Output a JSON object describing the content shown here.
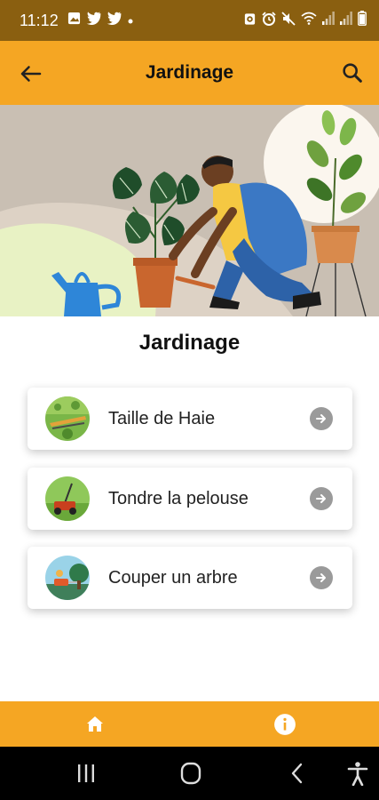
{
  "status_bar": {
    "time": "11:12",
    "left_icons": [
      "image-icon",
      "twitter-icon",
      "twitter-icon",
      "dot-icon"
    ],
    "right_icons": [
      "alarm-icon",
      "alarm-clock-icon",
      "mute-icon",
      "wifi-icon",
      "signal-icon",
      "signal-icon",
      "battery-icon"
    ]
  },
  "app_bar": {
    "title": "Jardinage",
    "back_icon": "arrow-left-icon",
    "search_icon": "search-icon"
  },
  "hero": {
    "illustration": "gardener-repotting-plant-illustration"
  },
  "section": {
    "title": "Jardinage"
  },
  "items": [
    {
      "label": "Taille de Haie",
      "thumb": "hedge-trimming-thumbnail",
      "action_icon": "arrow-right-circle-icon"
    },
    {
      "label": "Tondre la pelouse",
      "thumb": "lawn-mower-thumbnail",
      "action_icon": "arrow-right-circle-icon"
    },
    {
      "label": "Couper un arbre",
      "thumb": "tree-cutting-thumbnail",
      "action_icon": "arrow-right-circle-icon"
    }
  ],
  "bottom_nav": {
    "home_icon": "home-icon",
    "info_icon": "info-icon"
  },
  "system_nav": {
    "buttons": [
      "recents-icon",
      "home-circle-icon",
      "back-chevron-icon",
      "accessibility-icon"
    ]
  },
  "colors": {
    "status_bar": "#8a5f10",
    "accent": "#f5a623",
    "action_icon": "#9a9a9a",
    "system_nav": "#000000"
  }
}
